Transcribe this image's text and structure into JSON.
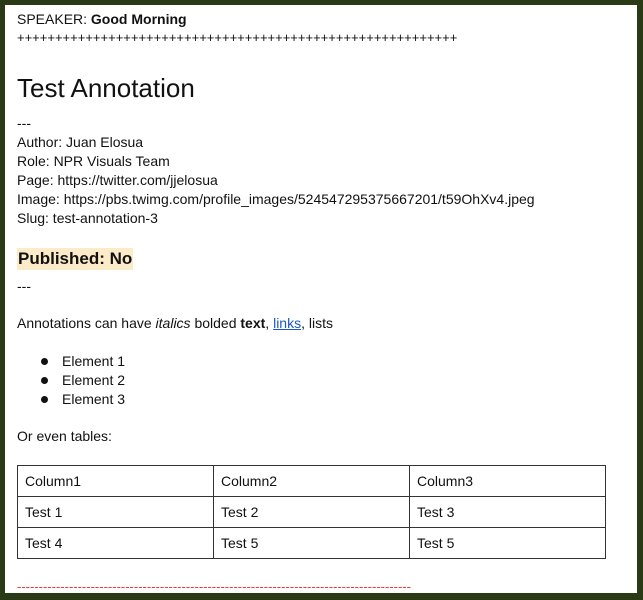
{
  "speaker": {
    "label": "SPEAKER:",
    "name": "Good Morning"
  },
  "separator_plus": "++++++++++++++++++++++++++++++++++++++++++++++++++++++++++",
  "title": "Test Annotation",
  "meta_divider_top": "---",
  "meta": {
    "author": "Author: Juan Elosua",
    "role": "Role: NPR Visuals Team",
    "page": "Page: https://twitter.com/jjelosua",
    "image": "Image: https://pbs.twimg.com/profile_images/524547295375667201/t59OhXv4.jpeg",
    "slug": "Slug: test-annotation-3"
  },
  "published": "Published: No",
  "meta_divider_bottom": "---",
  "paragraph": {
    "prefix": "Annotations can have ",
    "italic": "italics",
    "middle": " bolded ",
    "bold": "text",
    "comma1": ", ",
    "link": "links",
    "suffix": ", lists"
  },
  "list_items": [
    "Element 1",
    "Element 2",
    "Element 3"
  ],
  "tables_intro": "Or even tables:",
  "table": {
    "headers": [
      "Column1",
      "Column2",
      "Column3"
    ],
    "rows": [
      [
        "Test 1",
        "Test 2",
        "Test 3"
      ],
      [
        "Test 4",
        "Test 5",
        "Test 5"
      ]
    ]
  },
  "separator_dash": "-------------------------------------------------------------------------------------------",
  "colors": {
    "frame": "#2b3a16",
    "published_highlight": "#fcebc8",
    "link": "#1a56c8",
    "red_separator": "#e23c3c"
  }
}
